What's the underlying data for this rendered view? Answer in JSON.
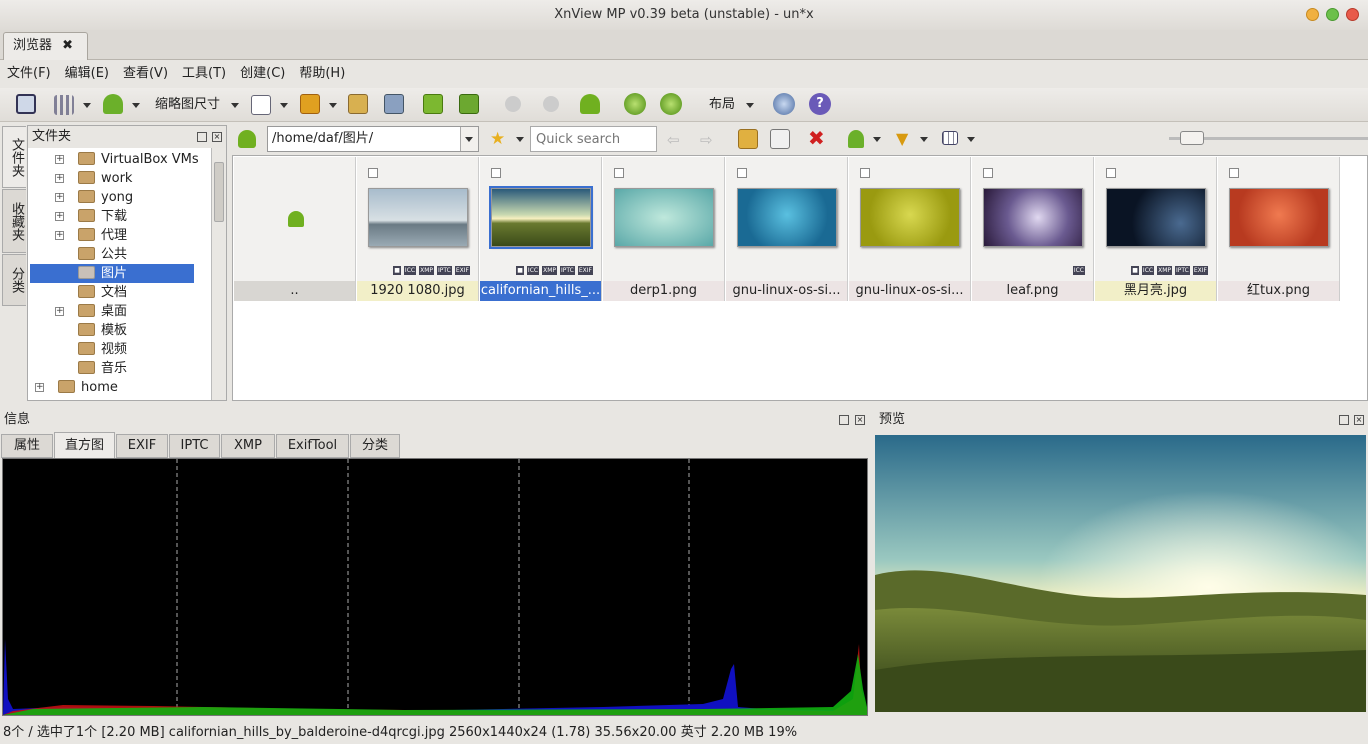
{
  "window": {
    "title": "XnView MP v0.39 beta (unstable) - un*x"
  },
  "tab": {
    "label": "浏览器",
    "close": "✖"
  },
  "menu": [
    "文件(F)",
    "编辑(E)",
    "查看(V)",
    "工具(T)",
    "创建(C)",
    "帮助(H)"
  ],
  "toolbar": {
    "thumb_size_label": "缩略图尺寸",
    "layout_label": "布局"
  },
  "left_tabs": [
    "文件夹",
    "收藏夹",
    "分类"
  ],
  "folders": {
    "title": "文件夹",
    "items": [
      {
        "label": "VirtualBox VMs",
        "expandable": true
      },
      {
        "label": "work",
        "expandable": true
      },
      {
        "label": "yong",
        "expandable": true
      },
      {
        "label": "下载",
        "expandable": true
      },
      {
        "label": "代理",
        "expandable": true
      },
      {
        "label": "公共",
        "expandable": false
      },
      {
        "label": "图片",
        "expandable": false,
        "selected": true
      },
      {
        "label": "文档",
        "expandable": false
      },
      {
        "label": "桌面",
        "expandable": true
      },
      {
        "label": "模板",
        "expandable": false
      },
      {
        "label": "视频",
        "expandable": false
      },
      {
        "label": "音乐",
        "expandable": false
      },
      {
        "label": "home",
        "expandable": true
      }
    ]
  },
  "path": {
    "value": "/home/daf/图片/",
    "search_placeholder": "Quick search"
  },
  "thumbnails": [
    {
      "label": "..",
      "kind": "parent"
    },
    {
      "label": "1920 1080.jpg",
      "badges": [
        "■",
        "ICC",
        "XMP",
        "IPTC",
        "EXIF"
      ],
      "bg": "#f2efc8"
    },
    {
      "label": "californian_hills_...",
      "badges": [
        "■",
        "ICC",
        "XMP",
        "IPTC",
        "EXIF"
      ],
      "selected": true
    },
    {
      "label": "derp1.png",
      "badges": [],
      "bg": "#ece4e4"
    },
    {
      "label": "gnu-linux-os-si...",
      "badges": [],
      "bg": "#ece4e4"
    },
    {
      "label": "gnu-linux-os-si...",
      "badges": [],
      "bg": "#ece4e4"
    },
    {
      "label": "leaf.png",
      "badges": [
        "ICC"
      ],
      "bg": "#ece4e4"
    },
    {
      "label": "黑月亮.jpg",
      "badges": [
        "■",
        "ICC",
        "XMP",
        "IPTC",
        "EXIF"
      ],
      "bg": "#f2efc8"
    },
    {
      "label": "红tux.png",
      "badges": [],
      "bg": "#ece4e4"
    }
  ],
  "info": {
    "title": "信息",
    "tabs": [
      "属性",
      "直方图",
      "EXIF",
      "IPTC",
      "XMP",
      "ExifTool",
      "分类"
    ],
    "active_tab": "直方图"
  },
  "preview": {
    "title": "预览"
  },
  "status": {
    "text": "8个 / 选中了1个 [2.20 MB]   californian_hills_by_balderoine-d4qrcgi.jpg   2560x1440x24 (1.78)   35.56x20.00 英寸   2.20 MB   19%"
  }
}
